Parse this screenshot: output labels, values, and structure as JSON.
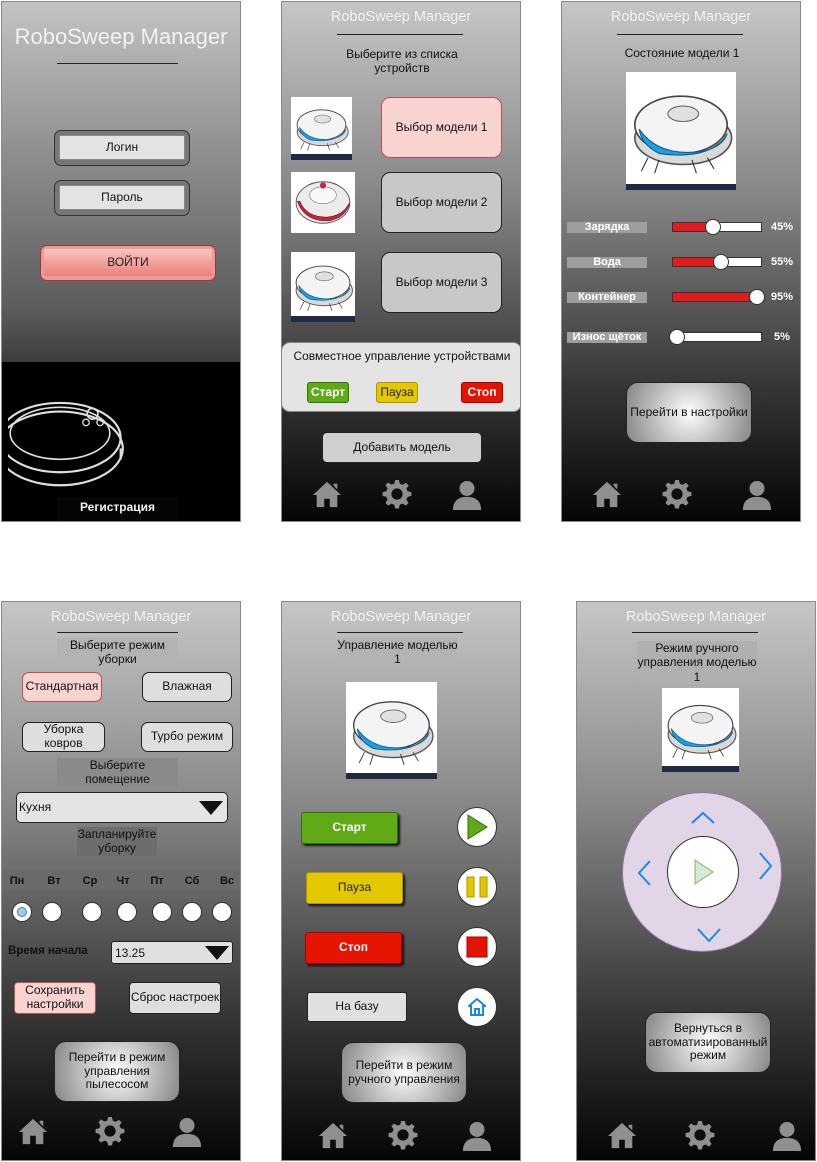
{
  "app_title": "RoboSweep Manager",
  "login": {
    "login_label": "Логин",
    "password_label": "Пароль",
    "enter_button": "ВОЙТИ",
    "register_link": "Регистрация"
  },
  "device_list": {
    "subtitle": "Выберите из списка устройств",
    "models": [
      {
        "label": "Выбор модели 1",
        "selected": true
      },
      {
        "label": "Выбор модели 2",
        "selected": false
      },
      {
        "label": "Выбор модели 3",
        "selected": false
      }
    ],
    "joint_control_title": "Совместное управление устройствами",
    "start": "Старт",
    "pause": "Пауза",
    "stop": "Стоп",
    "add_model": "Добавить модель"
  },
  "status": {
    "title": "Состояние модели 1",
    "metrics": [
      {
        "label": "Зарядка",
        "percent": 45,
        "text": "45%"
      },
      {
        "label": "Вода",
        "percent": 55,
        "text": "55%"
      },
      {
        "label": "Контейнер",
        "percent": 95,
        "text": "95%"
      },
      {
        "label": "Износ щёток",
        "percent": 5,
        "text": "5%"
      }
    ],
    "settings_button": "Перейти в настройки"
  },
  "settings": {
    "mode_title": "Выберите режим уборки",
    "modes": [
      "Стандартная",
      "Влажная",
      "Уборка ковров",
      "Турбо режим"
    ],
    "room_title": "Выберите помещение",
    "room_value": "Кухня",
    "schedule_title": "Запланируйте уборку",
    "days": [
      "Пн",
      "Вт",
      "Ср",
      "Чт",
      "Пт",
      "Сб",
      "Вс"
    ],
    "start_time_label": "Время начала",
    "start_time_value": "13.25",
    "save_button": "Сохранить настройки",
    "reset_button": "Сброс настроек",
    "manual_mode_button": "Перейти в режим управления пылесосом"
  },
  "control": {
    "title": "Управление моделью 1",
    "start": "Старт",
    "pause": "Пауза",
    "stop": "Стоп",
    "home": "На базу",
    "manual_button": "Перейти в режим ручного управления"
  },
  "manual": {
    "title": "Режим ручного управления моделью 1",
    "back_button": "Вернуться в автоматизированный режим"
  },
  "colors": {
    "green": "#60a917",
    "yellow": "#e3c800",
    "red": "#e51400",
    "pink": "#f8d3cf",
    "lilac": "#e1d5e7",
    "accent_blue": "#1e88e5"
  }
}
